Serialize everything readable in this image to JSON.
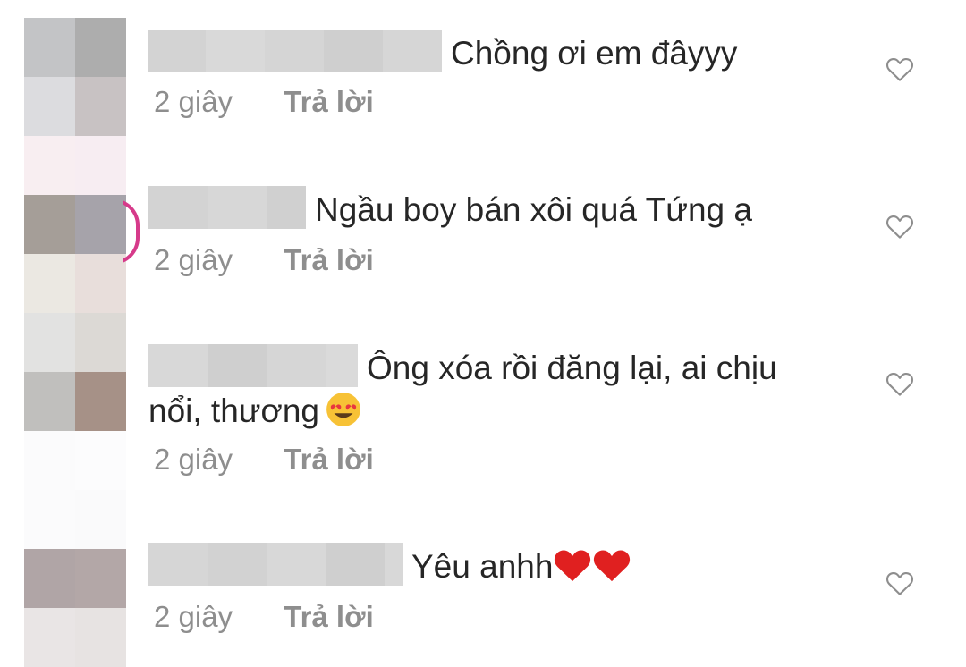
{
  "comments": [
    {
      "text": "Chồng ơi em đâyyy",
      "time": "2 giây",
      "reply_label": "Trả lời"
    },
    {
      "text": "Ngầu boy bán xôi quá Tứng ạ",
      "time": "2 giây",
      "reply_label": "Trả lời"
    },
    {
      "text_line1": "Ông xóa rồi đăng lại, ai chịu",
      "text_line2": "nổi, thương",
      "emoji": "heart-eyes-emoji",
      "time": "2 giây",
      "reply_label": "Trả lời"
    },
    {
      "text": "Yêu anhh",
      "emoji": "red-heart-emoji",
      "time": "2 giây",
      "reply_label": "Trả lời"
    }
  ],
  "colors": {
    "text": "#262626",
    "meta": "#8e8e8e",
    "story_ring": "#d63a8a",
    "heart_emoji": "#e02020"
  },
  "icons": [
    "heart-outline-icon"
  ]
}
